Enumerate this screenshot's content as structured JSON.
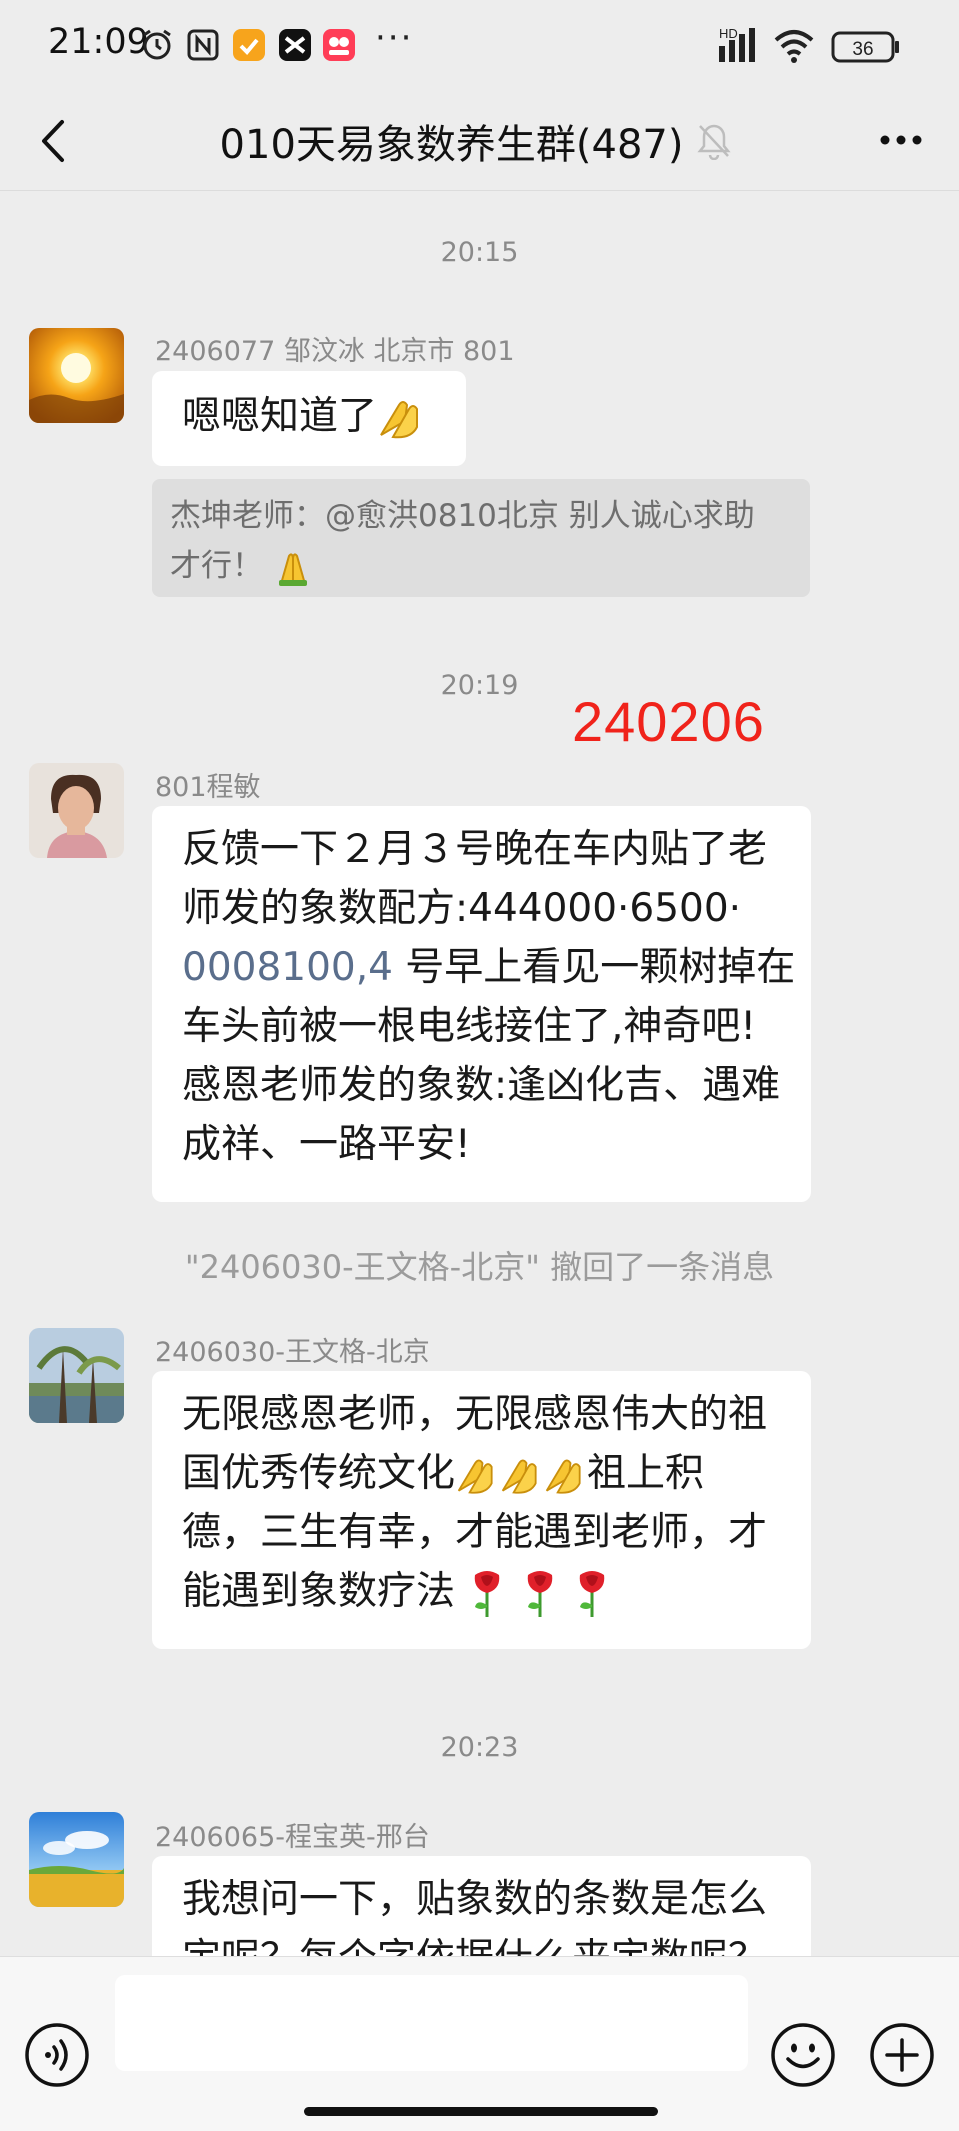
{
  "status_bar": {
    "time": "21:09",
    "more": "···",
    "battery": "36",
    "network": "HD"
  },
  "nav": {
    "title": "010天易象数养生群(487)"
  },
  "messages": {
    "time_1": "20:15",
    "msg1": {
      "sender": "2406077 邹汶冰  北京市   801",
      "text": "嗯嗯知道了",
      "quote_line1": "杰坤老师：@愈洪0810北京 别人诚心求助",
      "quote_line2": "才行！"
    },
    "time_2": "20:19",
    "annotation": "240206",
    "msg2": {
      "sender": "801程敏",
      "line1": "反馈一下２月３号晚在车内贴了老",
      "line2": "师发的象数配方:444000·6500·",
      "line3_link": "0008100,4",
      "line3_rest": " 号早上看见一颗树掉在",
      "line4": "车头前被一根电线接住了,神奇吧!",
      "line5": "感恩老师发的象数:逢凶化吉、遇难",
      "line6": "成祥、一路平安!"
    },
    "recall": "\"2406030-王文格-北京\" 撤回了一条消息",
    "msg3": {
      "sender": "2406030-王文格-北京",
      "line1": "无限感恩老师，无限感恩伟大的祖",
      "line2_a": "国优秀传统文化",
      "line2_b": "祖上积",
      "line3": "德，三生有幸，才能遇到老师，才",
      "line4": "能遇到象数疗法"
    },
    "time_3": "20:23",
    "msg4": {
      "sender": "2406065-程宝英-邢台",
      "line1": "我想问一下，贴象数的条数是怎么",
      "line2": "定呢？每个字依据什么来定数呢？"
    }
  },
  "colors": {
    "background": "#ededed",
    "bubble": "#ffffff",
    "annotation_red": "#f0231b",
    "link": "#5a6e8c"
  },
  "icons": [
    "alarm-icon",
    "nfc-icon",
    "app-icon",
    "capcut-icon",
    "shop-icon",
    "signal-icon",
    "wifi-icon",
    "battery-icon",
    "back-icon",
    "mute-bell-icon",
    "more-dots-icon",
    "voice-icon",
    "emoji-face-icon",
    "plus-icon"
  ]
}
